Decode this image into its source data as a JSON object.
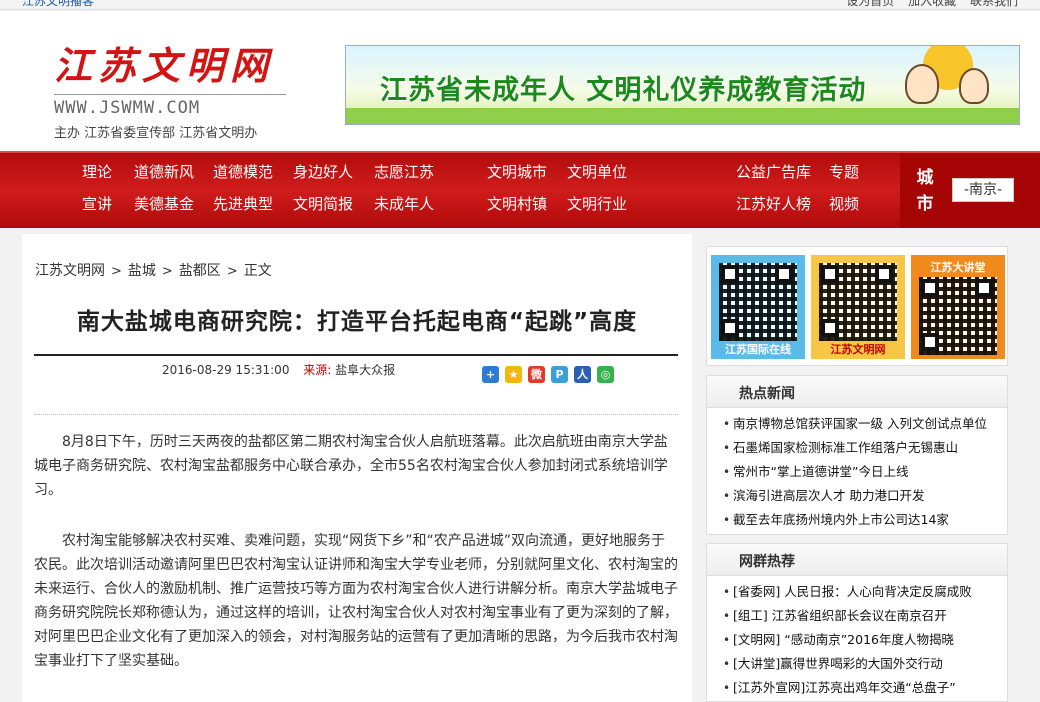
{
  "topbar": {
    "left": "江苏文明播客",
    "right": [
      "设为首页",
      "加入收藏",
      "联系我们"
    ]
  },
  "header": {
    "logo_title": "江苏文明网",
    "logo_url": "WWW.JSWMW.COM",
    "sponsor": "主办 江苏省委宣传部 江苏省文明办",
    "banner_text": "江苏省未成年人 文明礼仪养成教育活动"
  },
  "nav": {
    "row1": [
      "理论",
      "道德新风",
      "道德模范",
      "身边好人",
      "志愿江苏",
      "文明城市",
      "文明单位",
      "公益广告库",
      "专题"
    ],
    "row2": [
      "宣讲",
      "美德基金",
      "先进典型",
      "文明简报",
      "未成年人",
      "文明村镇",
      "文明行业",
      "江苏好人榜",
      "视频"
    ],
    "city_label": "城市",
    "city_value": "-南京-"
  },
  "article": {
    "breadcrumb": [
      "江苏文明网",
      "盐城",
      "盐都区",
      "正文"
    ],
    "title": "南大盐城电商研究院：打造平台托起电商“起跳”高度",
    "datetime": "2016-08-29 15:31:00",
    "source_label": "来源:",
    "source": "盐阜大众报",
    "paragraphs": [
      "8月8日下午，历时三天两夜的盐都区第二期农村淘宝合伙人启航班落幕。此次启航班由南京大学盐城电子商务研究院、农村淘宝盐都服务中心联合承办，全市55名农村淘宝合伙人参加封闭式系统培训学习。",
      "农村淘宝能够解决农村买难、卖难问题，实现“网货下乡”和“农产品进城”双向流通，更好地服务于农民。此次培训活动邀请阿里巴巴农村淘宝认证讲师和淘宝大学专业老师，分别就阿里文化、农村淘宝的未来运行、合伙人的激励机制、推广运营技巧等方面为农村淘宝合伙人进行讲解分析。南京大学盐城电子商务研究院院长郑称德认为，通过这样的培训，让农村淘宝合伙人对农村淘宝事业有了更为深刻的了解，对阿里巴巴企业文化有了更加深入的领会，对村淘服务站的运营有了更加清晰的思路，为今后我市农村淘宝事业打下了坚实基础。"
    ]
  },
  "share_icons": [
    "plus-icon",
    "qzone-icon",
    "weibo-icon",
    "tencent-weibo-icon",
    "renren-icon",
    "wechat-icon"
  ],
  "sidebar": {
    "qr_captions": [
      "江苏国际在线",
      "江苏文明网",
      "江苏大讲堂"
    ],
    "hot_news": {
      "heading": "热点新闻",
      "items": [
        "南京博物总馆获评国家一级 入列文创试点单位",
        "石墨烯国家检测标准工作组落户无锡惠山",
        "常州市“掌上道德讲堂”今日上线",
        "滨海引进高层次人才 助力港口开发",
        "截至去年底扬州境内外上市公司达14家"
      ]
    },
    "web_group": {
      "heading": "网群热荐",
      "items": [
        "[省委网] 人民日报：人心向背决定反腐成败",
        "[组工] 江苏省组织部长会议在南京召开",
        "[文明网] “感动南京”2016年度人物揭晓",
        "[大讲堂]赢得世界喝彩的大国外交行动",
        "[江苏外宣网]江苏亮出鸡年交通“总盘子”"
      ]
    }
  },
  "colors": {
    "nav_red": "#c41414",
    "brand_red": "#d21414",
    "banner_green": "#1b8a1b"
  }
}
